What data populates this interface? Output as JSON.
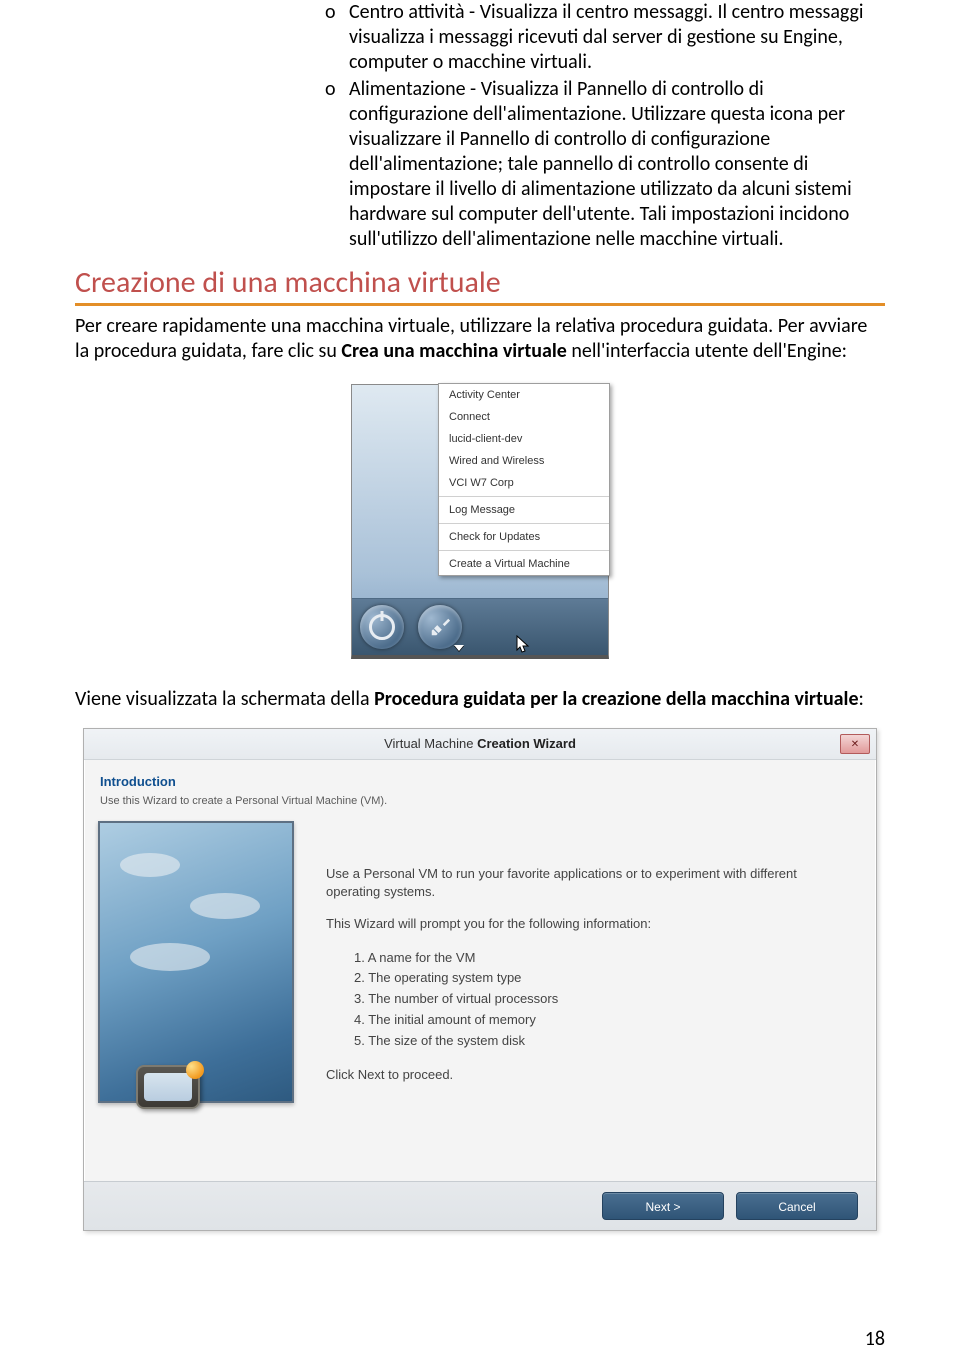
{
  "bullets": [
    {
      "marker": "o",
      "text": "Centro attività - Visualizza il centro messaggi. Il centro messaggi visualizza i messaggi ricevuti dal server di gestione su Engine, computer o macchine virtuali."
    },
    {
      "marker": "o",
      "text": "Alimentazione - Visualizza il Pannello di controllo di configurazione dell'alimentazione. Utilizzare questa icona per visualizzare il Pannello di controllo di configurazione dell'alimentazione; tale pannello di controllo consente di impostare il livello di alimentazione utilizzato da alcuni sistemi hardware sul computer dell'utente. Tali impostazioni incidono sull'utilizzo dell'alimentazione nelle macchine virtuali."
    }
  ],
  "heading": "Creazione di una macchina virtuale",
  "para1": {
    "before": "Per creare rapidamente una macchina virtuale, utilizzare la relativa procedura guidata. Per avviare la procedura guidata, fare clic su ",
    "bold": "Crea una macchina virtuale",
    "after": " nell'interfaccia utente dell'Engine:"
  },
  "menu": {
    "items": [
      "Activity Center",
      "Connect",
      "lucid-client-dev",
      "Wired and Wireless",
      "VCI W7 Corp"
    ],
    "items2": [
      "Log Message"
    ],
    "items3": [
      "Check for Updates"
    ],
    "items4": [
      "Create a Virtual Machine"
    ]
  },
  "para2": {
    "before": "Viene visualizzata la schermata della ",
    "bold": "Procedura guidata per la creazione della macchina virtuale",
    "after": ":"
  },
  "wizard": {
    "title_plain": "Virtual Machine ",
    "title_bold": "Creation Wizard",
    "intro_title": "Introduction",
    "intro_sub": "Use this Wizard to create a Personal Virtual Machine (VM).",
    "line1": "Use a Personal VM to run your favorite applications or to experiment with different operating systems.",
    "line2": "This Wizard will prompt you for the following information:",
    "list": [
      "1. A name for the VM",
      "2. The operating system type",
      "3. The number of virtual processors",
      "4. The initial amount of memory",
      "5. The size of the system disk"
    ],
    "line3": "Click Next to proceed.",
    "next": "Next >",
    "cancel": "Cancel"
  },
  "page_number": "18"
}
